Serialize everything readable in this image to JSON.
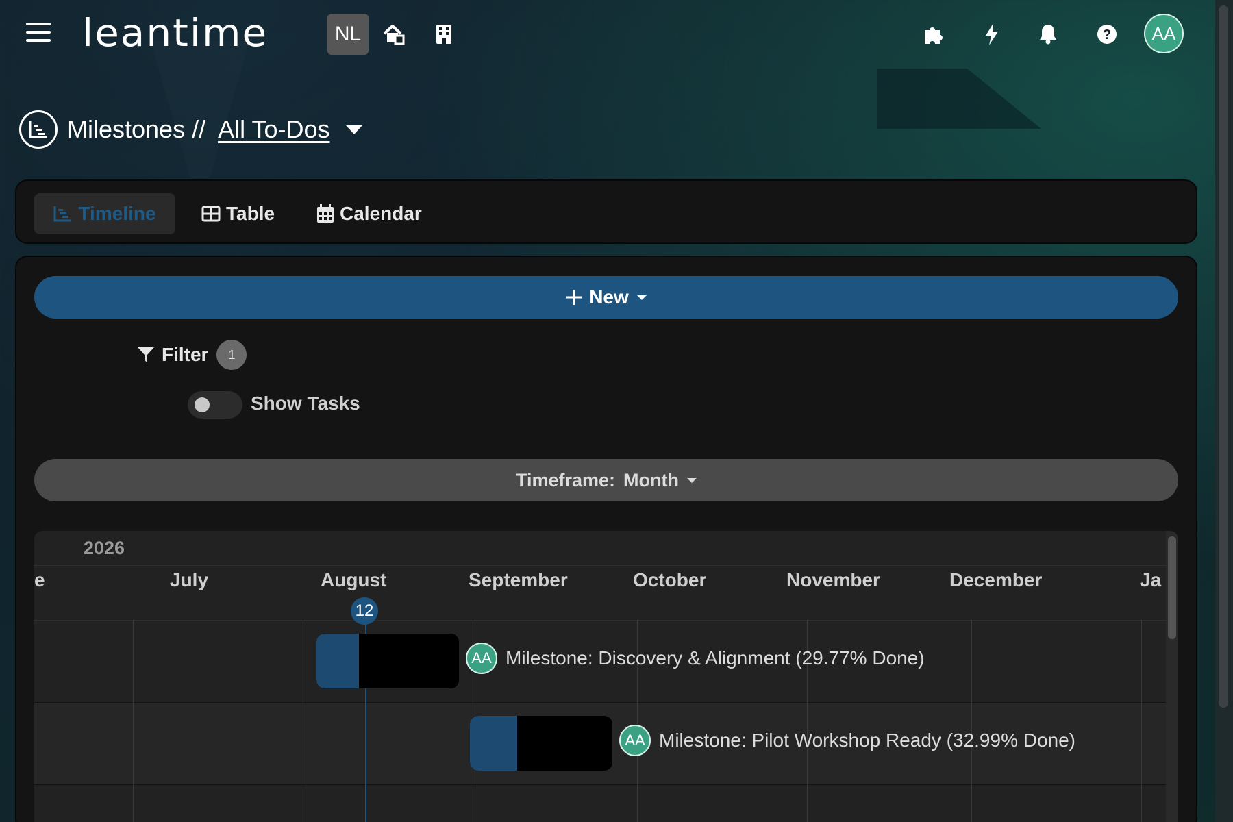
{
  "app": {
    "logo": "leantime",
    "project_badge": "NL",
    "user_initials": "AA"
  },
  "icons": {
    "menu": "hamburger-icon",
    "home": "home-icon",
    "company": "building-icon",
    "apps": "puzzle-icon",
    "quick_actions": "bolt-icon",
    "notifications": "bell-icon",
    "help": "question-circle-icon",
    "milestones": "timeline-icon"
  },
  "breadcrumb": {
    "section": "Milestones //",
    "current": "All To-Dos "
  },
  "tabs": [
    {
      "label": "Timeline",
      "active": true
    },
    {
      "label": "Table",
      "active": false
    },
    {
      "label": "Calendar",
      "active": false
    }
  ],
  "toolbar": {
    "new_label": "New",
    "filter_label": "Filter",
    "filter_count": "1",
    "show_tasks_label": "Show Tasks",
    "show_tasks_on": false,
    "timeframe_prefix": "Timeframe:",
    "timeframe_value": "Month"
  },
  "gantt": {
    "year": "2026",
    "months": [
      "e",
      "July",
      "August",
      "September",
      "October",
      "November",
      "December",
      "Ja"
    ],
    "today_label": "12",
    "milestones": [
      {
        "avatar": "AA",
        "label": "Milestone: Discovery & Alignment (29.77% Done)",
        "progress": 0.2977
      },
      {
        "avatar": "AA",
        "label": "Milestone: Pilot Workshop Ready (32.99% Done)",
        "progress": 0.3299
      }
    ]
  },
  "colors": {
    "accent": "#1e5580",
    "avatar": "#3aa182",
    "panel": "#141414"
  }
}
